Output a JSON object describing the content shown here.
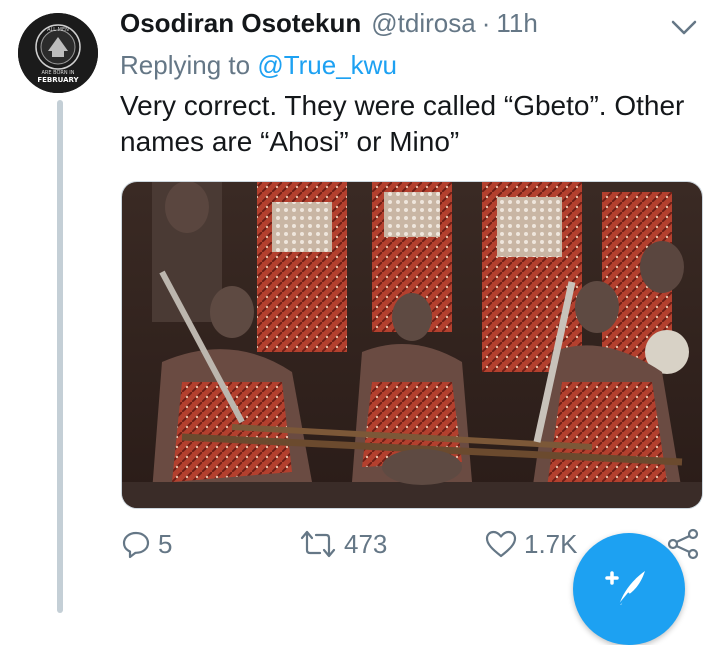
{
  "tweet": {
    "author": {
      "display_name": "Osodiran Osotekun",
      "handle": "@tdirosa",
      "avatar_text_top": "ALL MEN",
      "avatar_text_mid": "ARE BORN IN",
      "avatar_text_bottom": "FEBRUARY"
    },
    "separator": "·",
    "time": "11h",
    "replying_prefix": "Replying to",
    "replying_to": "@True_kwu",
    "text": "Very correct. They were called “Gbeto”. Other names are “Ahosi” or Mino”"
  },
  "actions": {
    "reply": {
      "icon": "reply-icon",
      "count": "5"
    },
    "retweet": {
      "icon": "retweet-icon",
      "count": "473"
    },
    "like": {
      "icon": "heart-icon",
      "count": "1.7K"
    },
    "share": {
      "icon": "share-icon"
    }
  },
  "compose": {
    "icon": "compose-tweet-icon"
  },
  "colors": {
    "accent": "#1da1f2",
    "secondary_text": "#657786",
    "primary_text": "#14171a",
    "thread_line": "#c4cfd6"
  }
}
